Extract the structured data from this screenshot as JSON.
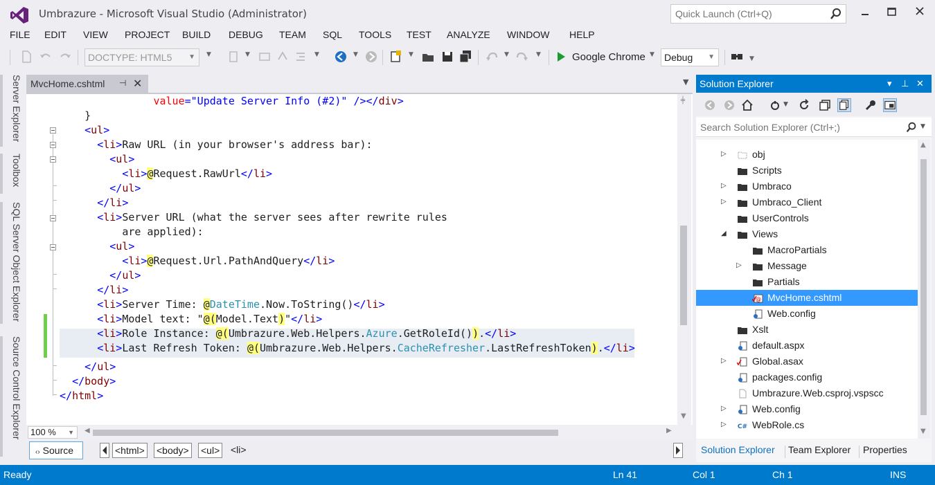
{
  "window": {
    "title": "Umbrazure - Microsoft Visual Studio (Administrator)",
    "quick_launch_placeholder": "Quick Launch (Ctrl+Q)"
  },
  "menu": [
    "FILE",
    "EDIT",
    "VIEW",
    "PROJECT",
    "BUILD",
    "DEBUG",
    "TEAM",
    "SQL",
    "TOOLS",
    "TEST",
    "ANALYZE",
    "WINDOW",
    "HELP"
  ],
  "toolbar": {
    "doctype": "DOCTYPE: HTML5",
    "browser": "Google Chrome",
    "config": "Debug"
  },
  "left_dock": [
    "Server Explorer",
    "Toolbox",
    "SQL Server Object Explorer",
    "Source Control Explorer"
  ],
  "editor": {
    "tab_title": "MvcHome.cshtml",
    "zoom": "100 %",
    "view_button": "Source",
    "breadcrumb": [
      "<html>",
      "<body>",
      "<ul>",
      "<li>"
    ],
    "code": {
      "l1": {
        "attr": "value",
        "eq": "=",
        "str": "\"Update Server Info (#2)\"",
        "tail": " /></",
        "tag": "div",
        "end": ">"
      },
      "l2": "}",
      "l3_tag": "ul",
      "l4_tag": "li",
      "l4_text": "Raw URL (in your browser's address bar):",
      "l5_tag": "ul",
      "l6_tag": "li",
      "l6_at": "@",
      "l6_expr": "Request.RawUrl",
      "l7_tag": "ul",
      "l8_tag": "li",
      "l9_tag": "li",
      "l9_text": "Server URL (what the server sees after rewrite rules",
      "l10_text": "are applied):",
      "l11_tag": "ul",
      "l12_tag": "li",
      "l12_at": "@",
      "l12_expr": "Request.Url.PathAndQuery",
      "l13_tag": "ul",
      "l14_tag": "li",
      "l15_tag": "li",
      "l15_text": "Server Time: ",
      "l15_at": "@",
      "l15_type": "DateTime",
      "l15_rest": ".Now.ToString()",
      "l16_tag": "li",
      "l16_text": "Model text: \"",
      "l16_at": "@(",
      "l16_expr": "Model.Text",
      "l16_close": ")",
      "l16_q": "\"",
      "l17_tag": "li",
      "l17_text": "Role Instance: ",
      "l17_at": "@(",
      "l17_expr1": "Umbrazure.Web.Helpers.",
      "l17_type": "Azure",
      "l17_expr2": ".GetRoleId()",
      "l17_close": ")",
      "l17_dot": ".",
      "l18_tag": "li",
      "l18_text": "Last Refresh Token: ",
      "l18_at": "@(",
      "l18_expr1": "Umbrazure.Web.Helpers.",
      "l18_type": "CacheRefresher",
      "l18_expr2": ".LastRefreshToken",
      "l18_close": ")",
      "l18_dot": ".",
      "l19_tag": "ul",
      "l20_tag": "body",
      "l21_tag": "html"
    }
  },
  "solution_explorer": {
    "title": "Solution Explorer",
    "search_placeholder": "Search Solution Explorer (Ctrl+;)",
    "items": [
      {
        "label": "obj",
        "icon": "folder-outline-icon",
        "expander": "collapsed",
        "indent": 0
      },
      {
        "label": "Scripts",
        "icon": "folder-icon",
        "expander": "none",
        "indent": 0
      },
      {
        "label": "Umbraco",
        "icon": "folder-icon",
        "expander": "collapsed",
        "indent": 0
      },
      {
        "label": "Umbraco_Client",
        "icon": "folder-icon",
        "expander": "collapsed",
        "indent": 0
      },
      {
        "label": "UserControls",
        "icon": "folder-icon",
        "expander": "none",
        "indent": 0
      },
      {
        "label": "Views",
        "icon": "folder-icon",
        "expander": "expanded",
        "indent": 0
      },
      {
        "label": "MacroPartials",
        "icon": "folder-icon",
        "expander": "none",
        "indent": 1
      },
      {
        "label": "Message",
        "icon": "folder-icon",
        "expander": "collapsed",
        "indent": 1
      },
      {
        "label": "Partials",
        "icon": "folder-icon",
        "expander": "none",
        "indent": 1
      },
      {
        "label": "MvcHome.cshtml",
        "icon": "razor-file-icon",
        "expander": "none",
        "indent": 1,
        "selected": true
      },
      {
        "label": "Web.config",
        "icon": "config-file-icon",
        "expander": "none",
        "indent": 1
      },
      {
        "label": "Xslt",
        "icon": "folder-icon",
        "expander": "none",
        "indent": 0
      },
      {
        "label": "default.aspx",
        "icon": "aspx-file-icon",
        "expander": "none",
        "indent": 0
      },
      {
        "label": "Global.asax",
        "icon": "asax-file-icon",
        "expander": "collapsed",
        "indent": 0
      },
      {
        "label": "packages.config",
        "icon": "config-file-icon",
        "expander": "none",
        "indent": 0
      },
      {
        "label": "Umbrazure.Web.csproj.vspscc",
        "icon": "file-icon",
        "expander": "none",
        "indent": 0
      },
      {
        "label": "Web.config",
        "icon": "config-file-icon",
        "expander": "collapsed",
        "indent": 0
      },
      {
        "label": "WebRole.cs",
        "icon": "csharp-file-icon",
        "expander": "collapsed",
        "indent": 0
      }
    ],
    "tabs": [
      "Solution Explorer",
      "Team Explorer",
      "Properties"
    ]
  },
  "status": {
    "state": "Ready",
    "ln": "Ln 41",
    "col": "Col 1",
    "ch": "Ch 1",
    "mode": "INS"
  },
  "colors": {
    "accent": "#007acc",
    "selection": "#3399ff",
    "keyword": "#0000ff",
    "tag": "#800000",
    "type": "#2b91af",
    "razor_highlight": "#ffff80"
  }
}
